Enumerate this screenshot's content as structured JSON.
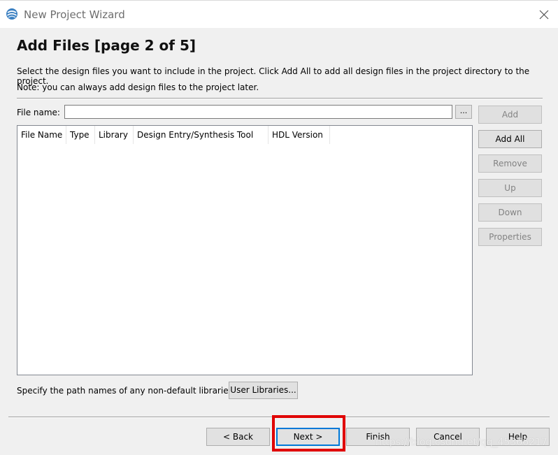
{
  "window": {
    "title": "New Project Wizard",
    "icon": "quartus-globe-icon"
  },
  "page": {
    "title": "Add Files [page 2 of 5]",
    "description": "Select the design files you want to include in the project. Click Add All to add all design files in the project directory to the project.",
    "note": "Note: you can always add design files to the project later."
  },
  "file_name": {
    "label": "File name:",
    "value": "",
    "browse_label": "..."
  },
  "table": {
    "columns": [
      "File Name",
      "Type",
      "Library",
      "Design Entry/Synthesis Tool",
      "HDL Version"
    ],
    "rows": []
  },
  "side_buttons": {
    "add": "Add",
    "add_all": "Add All",
    "remove": "Remove",
    "up": "Up",
    "down": "Down",
    "properties": "Properties"
  },
  "libraries": {
    "label": "Specify the path names of any non-default libraries.",
    "button": "User Libraries..."
  },
  "footer": {
    "back": "< Back",
    "next": "Next >",
    "finish": "Finish",
    "cancel": "Cancel",
    "help": "Help"
  },
  "watermark": "https://blog.csdn.net/qq_45366217",
  "colors": {
    "highlight": "#e00000",
    "default_button_border": "#0078d7"
  }
}
